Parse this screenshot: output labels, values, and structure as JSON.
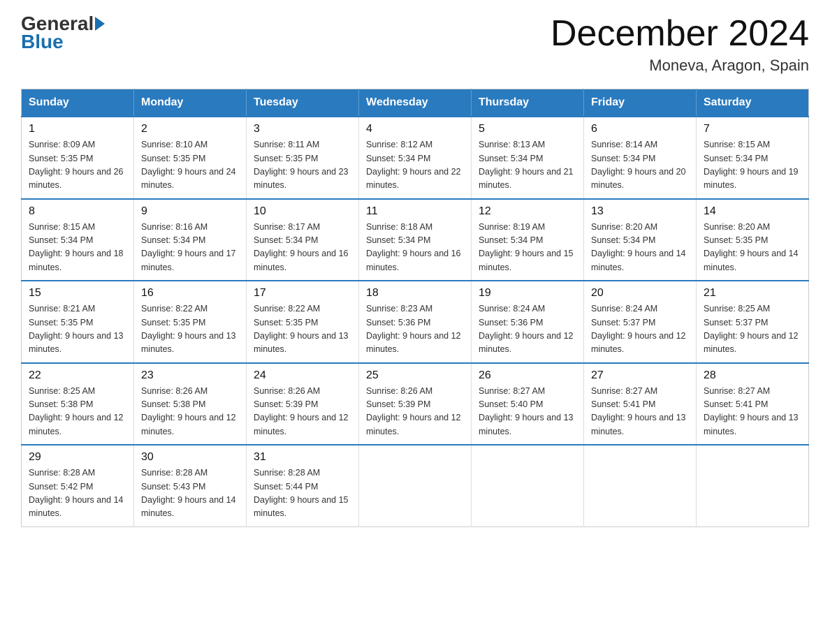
{
  "header": {
    "logo": {
      "general": "General",
      "blue": "Blue"
    },
    "title": "December 2024",
    "subtitle": "Moneva, Aragon, Spain"
  },
  "weekdays": [
    "Sunday",
    "Monday",
    "Tuesday",
    "Wednesday",
    "Thursday",
    "Friday",
    "Saturday"
  ],
  "weeks": [
    [
      {
        "day": 1,
        "sunrise": "8:09 AM",
        "sunset": "5:35 PM",
        "daylight": "9 hours and 26 minutes."
      },
      {
        "day": 2,
        "sunrise": "8:10 AM",
        "sunset": "5:35 PM",
        "daylight": "9 hours and 24 minutes."
      },
      {
        "day": 3,
        "sunrise": "8:11 AM",
        "sunset": "5:35 PM",
        "daylight": "9 hours and 23 minutes."
      },
      {
        "day": 4,
        "sunrise": "8:12 AM",
        "sunset": "5:34 PM",
        "daylight": "9 hours and 22 minutes."
      },
      {
        "day": 5,
        "sunrise": "8:13 AM",
        "sunset": "5:34 PM",
        "daylight": "9 hours and 21 minutes."
      },
      {
        "day": 6,
        "sunrise": "8:14 AM",
        "sunset": "5:34 PM",
        "daylight": "9 hours and 20 minutes."
      },
      {
        "day": 7,
        "sunrise": "8:15 AM",
        "sunset": "5:34 PM",
        "daylight": "9 hours and 19 minutes."
      }
    ],
    [
      {
        "day": 8,
        "sunrise": "8:15 AM",
        "sunset": "5:34 PM",
        "daylight": "9 hours and 18 minutes."
      },
      {
        "day": 9,
        "sunrise": "8:16 AM",
        "sunset": "5:34 PM",
        "daylight": "9 hours and 17 minutes."
      },
      {
        "day": 10,
        "sunrise": "8:17 AM",
        "sunset": "5:34 PM",
        "daylight": "9 hours and 16 minutes."
      },
      {
        "day": 11,
        "sunrise": "8:18 AM",
        "sunset": "5:34 PM",
        "daylight": "9 hours and 16 minutes."
      },
      {
        "day": 12,
        "sunrise": "8:19 AM",
        "sunset": "5:34 PM",
        "daylight": "9 hours and 15 minutes."
      },
      {
        "day": 13,
        "sunrise": "8:20 AM",
        "sunset": "5:34 PM",
        "daylight": "9 hours and 14 minutes."
      },
      {
        "day": 14,
        "sunrise": "8:20 AM",
        "sunset": "5:35 PM",
        "daylight": "9 hours and 14 minutes."
      }
    ],
    [
      {
        "day": 15,
        "sunrise": "8:21 AM",
        "sunset": "5:35 PM",
        "daylight": "9 hours and 13 minutes."
      },
      {
        "day": 16,
        "sunrise": "8:22 AM",
        "sunset": "5:35 PM",
        "daylight": "9 hours and 13 minutes."
      },
      {
        "day": 17,
        "sunrise": "8:22 AM",
        "sunset": "5:35 PM",
        "daylight": "9 hours and 13 minutes."
      },
      {
        "day": 18,
        "sunrise": "8:23 AM",
        "sunset": "5:36 PM",
        "daylight": "9 hours and 12 minutes."
      },
      {
        "day": 19,
        "sunrise": "8:24 AM",
        "sunset": "5:36 PM",
        "daylight": "9 hours and 12 minutes."
      },
      {
        "day": 20,
        "sunrise": "8:24 AM",
        "sunset": "5:37 PM",
        "daylight": "9 hours and 12 minutes."
      },
      {
        "day": 21,
        "sunrise": "8:25 AM",
        "sunset": "5:37 PM",
        "daylight": "9 hours and 12 minutes."
      }
    ],
    [
      {
        "day": 22,
        "sunrise": "8:25 AM",
        "sunset": "5:38 PM",
        "daylight": "9 hours and 12 minutes."
      },
      {
        "day": 23,
        "sunrise": "8:26 AM",
        "sunset": "5:38 PM",
        "daylight": "9 hours and 12 minutes."
      },
      {
        "day": 24,
        "sunrise": "8:26 AM",
        "sunset": "5:39 PM",
        "daylight": "9 hours and 12 minutes."
      },
      {
        "day": 25,
        "sunrise": "8:26 AM",
        "sunset": "5:39 PM",
        "daylight": "9 hours and 12 minutes."
      },
      {
        "day": 26,
        "sunrise": "8:27 AM",
        "sunset": "5:40 PM",
        "daylight": "9 hours and 13 minutes."
      },
      {
        "day": 27,
        "sunrise": "8:27 AM",
        "sunset": "5:41 PM",
        "daylight": "9 hours and 13 minutes."
      },
      {
        "day": 28,
        "sunrise": "8:27 AM",
        "sunset": "5:41 PM",
        "daylight": "9 hours and 13 minutes."
      }
    ],
    [
      {
        "day": 29,
        "sunrise": "8:28 AM",
        "sunset": "5:42 PM",
        "daylight": "9 hours and 14 minutes."
      },
      {
        "day": 30,
        "sunrise": "8:28 AM",
        "sunset": "5:43 PM",
        "daylight": "9 hours and 14 minutes."
      },
      {
        "day": 31,
        "sunrise": "8:28 AM",
        "sunset": "5:44 PM",
        "daylight": "9 hours and 15 minutes."
      },
      null,
      null,
      null,
      null
    ]
  ]
}
